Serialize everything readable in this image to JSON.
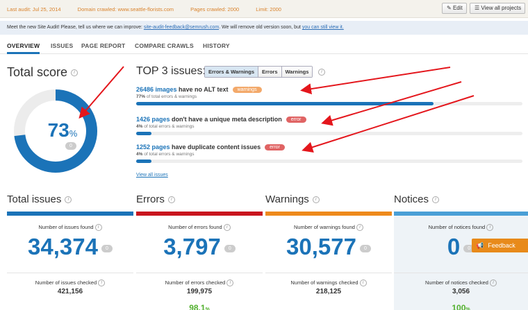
{
  "topbar": {
    "last_audit": "Last audit: Jul 25, 2014",
    "domain": "Domain crawled: www.seattle-florists.com",
    "pages": "Pages crawled: 2000",
    "limit": "Limit: 2000",
    "edit_label": "Edit",
    "view_all_label": "View all projects"
  },
  "notice": {
    "text": "Meet the new Site Audit! Please, tell us where we can improve: ",
    "email": "site-audit-feedback@semrush.com",
    "middle": ". We will remove old version soon, but ",
    "link": "you can still view it."
  },
  "tabs": [
    "OVERVIEW",
    "ISSUES",
    "PAGE REPORT",
    "COMPARE CRAWLS",
    "HISTORY"
  ],
  "score": {
    "title": "Total score",
    "value": "73",
    "unit": "%",
    "badge": "0",
    "fraction": 0.73
  },
  "top3": {
    "title": "TOP 3 issues:",
    "filters": [
      "Errors & Warnings",
      "Errors",
      "Warnings"
    ],
    "issues": [
      {
        "count": "26486 images",
        "text": " have no ALT text",
        "tag": "warnings",
        "tag_color": "#f3a96a",
        "pct": "77%",
        "pct_text": " of total errors & warnings",
        "fraction": 0.77
      },
      {
        "count": "1426 pages",
        "text": " don't have a unique meta description",
        "tag": "error",
        "tag_color": "#e06464",
        "pct": "4%",
        "pct_text": " of total errors & warnings",
        "fraction": 0.04
      },
      {
        "count": "1252 pages",
        "text": " have duplicate content issues",
        "tag": "error",
        "tag_color": "#e06464",
        "pct": "4%",
        "pct_text": " of total errors & warnings",
        "fraction": 0.04
      }
    ],
    "view_all": "View all issues"
  },
  "cards": [
    {
      "title": "Total issues",
      "color": "#1b73b8",
      "found_label": "Number of issues found",
      "found": "34,374",
      "pill": "0",
      "checked_label": "Number of issues checked",
      "checked": "421,156",
      "pct": "",
      "bg": "#ffffff"
    },
    {
      "title": "Errors",
      "color": "#c9151e",
      "found_label": "Number of errors found",
      "found": "3,797",
      "pill": "0",
      "checked_label": "Number of errors checked",
      "checked": "199,975",
      "pct": "98.1",
      "bg": "#ffffff"
    },
    {
      "title": "Warnings",
      "color": "#ee8a1c",
      "found_label": "Number of warnings found",
      "found": "30,577",
      "pill": "0",
      "checked_label": "Number of warnings checked",
      "checked": "218,125",
      "pct": "",
      "bg": "#ffffff"
    },
    {
      "title": "Notices",
      "color": "#4a9fd6",
      "found_label": "Number of notices found",
      "found": "0",
      "pill": "0",
      "checked_label": "Number of notices checked",
      "checked": "3,056",
      "pct": "100",
      "bg": "#eef3f7"
    }
  ],
  "feedback_label": "Feedback",
  "colors": {
    "accent": "#1b73b8",
    "arrow": "#e4161c"
  }
}
